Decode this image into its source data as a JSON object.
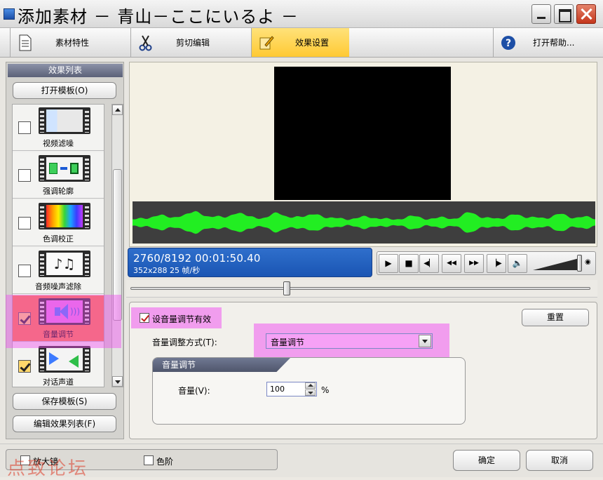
{
  "window": {
    "title": "添加素材 － 青山－ここにいるよ －"
  },
  "tabs": [
    {
      "label": "素材特性",
      "icon": "document-icon"
    },
    {
      "label": "剪切编辑",
      "icon": "scissors-icon"
    },
    {
      "label": "效果设置",
      "icon": "edit-effect-icon",
      "active": true
    },
    {
      "label": "打开帮助...",
      "icon": "help-icon"
    }
  ],
  "effects_panel": {
    "header": "效果列表",
    "open_template": "打开模板(O)",
    "save_template": "保存模板(S)",
    "edit_effect_list": "编辑效果列表(F)",
    "items": [
      {
        "name": "视频滤噪",
        "checked": false
      },
      {
        "name": "强调轮廓",
        "checked": false
      },
      {
        "name": "色调校正",
        "checked": false
      },
      {
        "name": "音频噪声滤除",
        "checked": false
      },
      {
        "name": "音量调节",
        "checked": true,
        "selected": true
      },
      {
        "name": "对话声道",
        "checked": true
      }
    ]
  },
  "player": {
    "frame_time": "2760/8192  00:01:50.40",
    "video_info": "352x288 25  帧/秒",
    "seek_position": 0.34,
    "volume_level": 0.95,
    "buttons": [
      {
        "name": "play-button",
        "glyph": "▶"
      },
      {
        "name": "stop-button",
        "glyph": "■"
      },
      {
        "name": "prev-frame-button",
        "glyph": "◀▏"
      },
      {
        "name": "rewind-button",
        "glyph": "◀◀"
      },
      {
        "name": "fast-forward-button",
        "glyph": "▶▶"
      },
      {
        "name": "next-frame-button",
        "glyph": "▕▶"
      },
      {
        "name": "speaker-button",
        "glyph": "🔈"
      }
    ]
  },
  "settings": {
    "enable_label": "设音量调节有效",
    "enabled": true,
    "reset_button": "重置",
    "mode_label": "音量调整方式(T):",
    "mode_value": "音量调节",
    "group_title": "音量调节",
    "volume_label": "音量(V):",
    "volume_value": "100",
    "volume_unit": "%"
  },
  "footer": {
    "magnifier": "放大镜",
    "color_scale": "色阶",
    "ok": "确定",
    "cancel": "取消",
    "watermark": "点致论坛"
  },
  "colors": {
    "accent_tab": "#ffc933",
    "selected_item": "#f97a3a",
    "highlight": "#f050f0",
    "waveform": "#22ee22",
    "time_box": "#1a55b3"
  }
}
